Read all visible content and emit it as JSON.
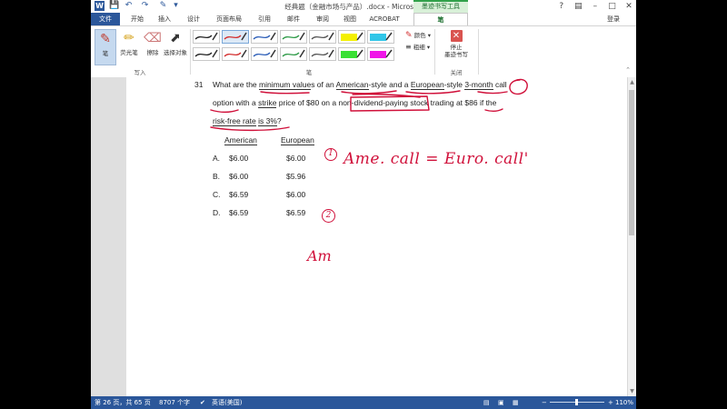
{
  "window": {
    "title": "经典题（金融市场与产品）.docx - Microsoft Word",
    "context_tab_group": "墨迹书写工具",
    "login": "登录"
  },
  "tabs": [
    "文件",
    "开始",
    "插入",
    "设计",
    "页面布局",
    "引用",
    "邮件",
    "审阅",
    "视图",
    "ACROBAT",
    "笔"
  ],
  "ribbon": {
    "write_group": {
      "label": "写入",
      "buttons": [
        {
          "label": "笔",
          "icon": "pen-icon"
        },
        {
          "label": "荧光笔",
          "icon": "highlighter-icon"
        },
        {
          "label": "擦除",
          "icon": "eraser-icon"
        },
        {
          "label": "选择对象",
          "icon": "select-cursor-icon"
        }
      ]
    },
    "pen_group": {
      "label": "笔",
      "color_label": "颜色",
      "thickness_label": "粗细",
      "swatches": [
        {
          "color": "#222222",
          "selected": false
        },
        {
          "color": "#d32f2f",
          "selected": true
        },
        {
          "color": "#2e5fb8",
          "selected": false
        },
        {
          "color": "#2e9a47",
          "selected": false
        },
        {
          "color": "#555555",
          "selected": false
        },
        {
          "color": "#f4f000",
          "selected": false
        },
        {
          "color": "#31c6e8",
          "selected": false
        },
        {
          "color": "#222222",
          "selected": false
        },
        {
          "color": "#d32f2f",
          "selected": false
        },
        {
          "color": "#2e5fb8",
          "selected": false
        },
        {
          "color": "#2e9a47",
          "selected": false
        },
        {
          "color": "#555555",
          "selected": false
        },
        {
          "color": "#39e034",
          "selected": false
        },
        {
          "color": "#f016e8",
          "selected": false
        }
      ]
    },
    "close_group": {
      "label": "关闭",
      "stop_label_1": "停止",
      "stop_label_2": "墨迹书写"
    }
  },
  "document": {
    "question_number": "31",
    "line1": {
      "a": "What are the ",
      "b": "minimum value",
      "c": "s of an ",
      "d": "American",
      "e": "-style and a ",
      "f": "European",
      "g": "-style ",
      "h": "3-month",
      "i": " ",
      "j": "call"
    },
    "line2": {
      "a": "option",
      "b": " with a ",
      "c": "strike",
      "d": " price of $80 on a ",
      "e": "non-dividend-paying",
      "f": " stock trading at ",
      "g": "$86",
      "h": " if the"
    },
    "line3": {
      "a": "risk-free rate",
      "b": " ",
      "c": "is 3%",
      "d": "?"
    },
    "col_headers": [
      "American",
      "European"
    ],
    "options": [
      {
        "letter": "A.",
        "american": "$6.00",
        "european": "$6.00"
      },
      {
        "letter": "B.",
        "american": "$6.00",
        "european": "$5.96"
      },
      {
        "letter": "C.",
        "american": "$6.59",
        "european": "$6.00"
      },
      {
        "letter": "D.",
        "american": "$6.59",
        "european": "$6.59"
      }
    ]
  },
  "handwriting": {
    "note1": "Ame. call = Euro. call'",
    "note2": "Am",
    "marker1": "1",
    "marker2": "2"
  },
  "status": {
    "page": "第 26 页，共 65 页",
    "words": "8707 个字",
    "language": "英语(美国)",
    "zoom": "110%",
    "zoom_out": "−",
    "zoom_in": "+"
  },
  "colors": {
    "accent": "#2b579a",
    "ink": "#d0103a",
    "ink_tools": "#31a14a"
  }
}
